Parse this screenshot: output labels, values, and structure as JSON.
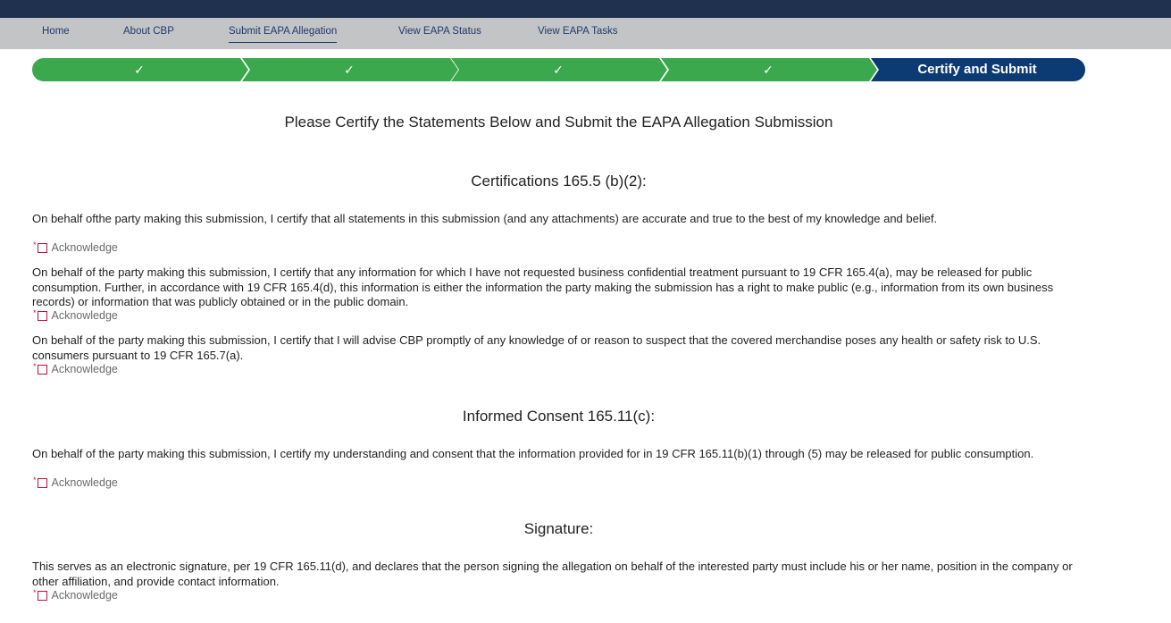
{
  "nav": {
    "items": [
      {
        "label": "Home"
      },
      {
        "label": "About CBP"
      },
      {
        "label": "Submit EAPA Allegation"
      },
      {
        "label": "View EAPA Status"
      },
      {
        "label": "View EAPA Tasks"
      }
    ],
    "active": "Submit EAPA Allegation"
  },
  "stepper": {
    "steps": [
      {
        "status": "complete",
        "icon": "check-icon"
      },
      {
        "status": "complete",
        "icon": "check-icon"
      },
      {
        "status": "complete",
        "icon": "check-icon"
      },
      {
        "status": "complete",
        "icon": "check-icon"
      },
      {
        "status": "current",
        "label": "Certify and Submit"
      }
    ],
    "colors": {
      "complete": "#3ca84d",
      "current": "#0c3a73"
    }
  },
  "page": {
    "title": "Please Certify the Statements Below and Submit the EAPA Allegation Submission"
  },
  "sections": [
    {
      "title": "Certifications 165.5 (b)(2):",
      "statements": [
        {
          "text": "On behalf ofthe party making this submission, I certify that all statements in this submission (and any attachments) are accurate and true to the best of my knowledge and belief.",
          "ack_label": "Acknowledge"
        },
        {
          "text": "On behalf of the party making this submission, I certify that any information for which I have not requested business confidential treatment pursuant to 19 CFR 165.4(a), may be released for public consumption. Further, in accordance with 19 CFR 165.4(d), this information is either the information the party making the submission has a right to make public (e.g., information from its own business records) or information that was publicly obtained or in the public domain.",
          "ack_label": "Acknowledge"
        },
        {
          "text": "On behalf of the party making this submission, I certify that I will advise CBP promptly of any knowledge of or reason to suspect that the covered merchandise poses any health or safety risk to U.S. consumers pursuant to 19 CFR 165.7(a).",
          "ack_label": "Acknowledge"
        }
      ]
    },
    {
      "title": "Informed Consent 165.11(c):",
      "statements": [
        {
          "text": "On behalf of the party making this submission, I certify my understanding and consent that the information provided for in 19 CFR 165.11(b)(1) through (5) may be released for public consumption.",
          "ack_label": "Acknowledge"
        }
      ]
    },
    {
      "title": "Signature:",
      "statements": [
        {
          "text": "This serves as an electronic signature, per 19 CFR 165.11(d), and declares that the person signing the allegation on behalf of the interested party must include his or her name, position in the company or other affiliation, and provide contact information.",
          "ack_label": "Acknowledge"
        }
      ]
    }
  ],
  "required_marker": "*",
  "colors": {
    "header": "#20304f",
    "nav_bg": "#c3c4c6",
    "nav_text": "#1f3a6e",
    "checkbox_border": "#b7163a"
  }
}
